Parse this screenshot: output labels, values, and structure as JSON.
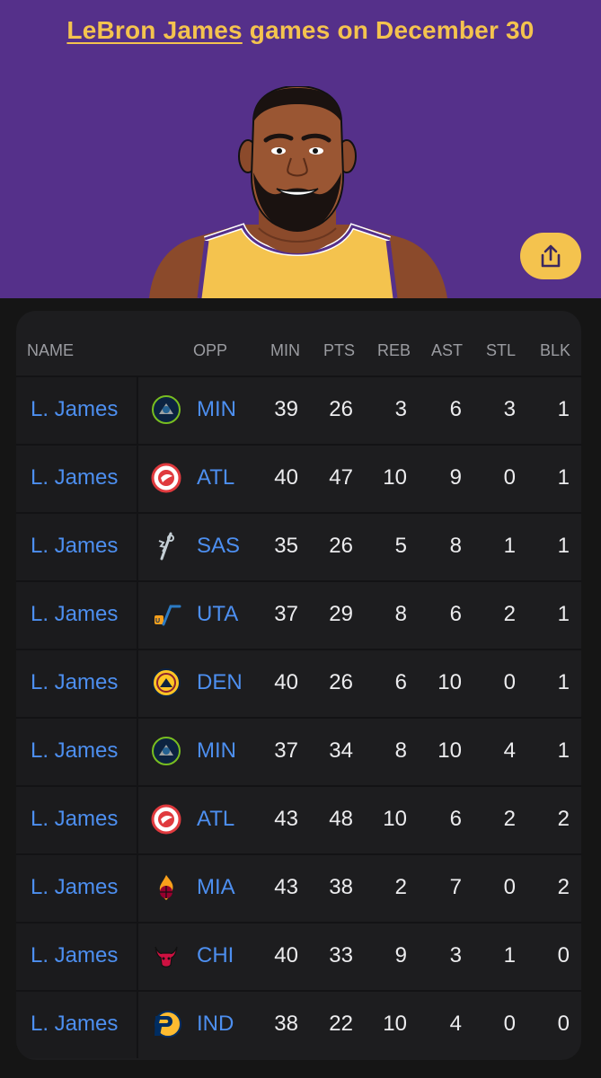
{
  "header": {
    "player_name": "LeBron James",
    "title_rest": " games on December 30"
  },
  "colors": {
    "accent": "#f4c34e",
    "hero_bg": "#55308a",
    "link": "#4d8ff0",
    "card_bg": "#1d1d1f"
  },
  "share_icon": "share-icon",
  "table": {
    "columns": [
      "NAME",
      "OPP",
      "MIN",
      "PTS",
      "REB",
      "AST",
      "STL",
      "BLK"
    ],
    "rows": [
      {
        "name": "L. James",
        "opp": "MIN",
        "logo": "timberwolves-logo-icon",
        "min": "39",
        "pts": "26",
        "reb": "3",
        "ast": "6",
        "stl": "3",
        "blk": "1"
      },
      {
        "name": "L. James",
        "opp": "ATL",
        "logo": "hawks-logo-icon",
        "min": "40",
        "pts": "47",
        "reb": "10",
        "ast": "9",
        "stl": "0",
        "blk": "1"
      },
      {
        "name": "L. James",
        "opp": "SAS",
        "logo": "spurs-logo-icon",
        "min": "35",
        "pts": "26",
        "reb": "5",
        "ast": "8",
        "stl": "1",
        "blk": "1"
      },
      {
        "name": "L. James",
        "opp": "UTA",
        "logo": "jazz-logo-icon",
        "min": "37",
        "pts": "29",
        "reb": "8",
        "ast": "6",
        "stl": "2",
        "blk": "1"
      },
      {
        "name": "L. James",
        "opp": "DEN",
        "logo": "nuggets-logo-icon",
        "min": "40",
        "pts": "26",
        "reb": "6",
        "ast": "10",
        "stl": "0",
        "blk": "1"
      },
      {
        "name": "L. James",
        "opp": "MIN",
        "logo": "timberwolves-logo-icon",
        "min": "37",
        "pts": "34",
        "reb": "8",
        "ast": "10",
        "stl": "4",
        "blk": "1"
      },
      {
        "name": "L. James",
        "opp": "ATL",
        "logo": "hawks-logo-icon",
        "min": "43",
        "pts": "48",
        "reb": "10",
        "ast": "6",
        "stl": "2",
        "blk": "2"
      },
      {
        "name": "L. James",
        "opp": "MIA",
        "logo": "heat-logo-icon",
        "min": "43",
        "pts": "38",
        "reb": "2",
        "ast": "7",
        "stl": "0",
        "blk": "2"
      },
      {
        "name": "L. James",
        "opp": "CHI",
        "logo": "bulls-logo-icon",
        "min": "40",
        "pts": "33",
        "reb": "9",
        "ast": "3",
        "stl": "1",
        "blk": "0"
      },
      {
        "name": "L. James",
        "opp": "IND",
        "logo": "pacers-logo-icon",
        "min": "38",
        "pts": "22",
        "reb": "10",
        "ast": "4",
        "stl": "0",
        "blk": "0"
      }
    ]
  }
}
